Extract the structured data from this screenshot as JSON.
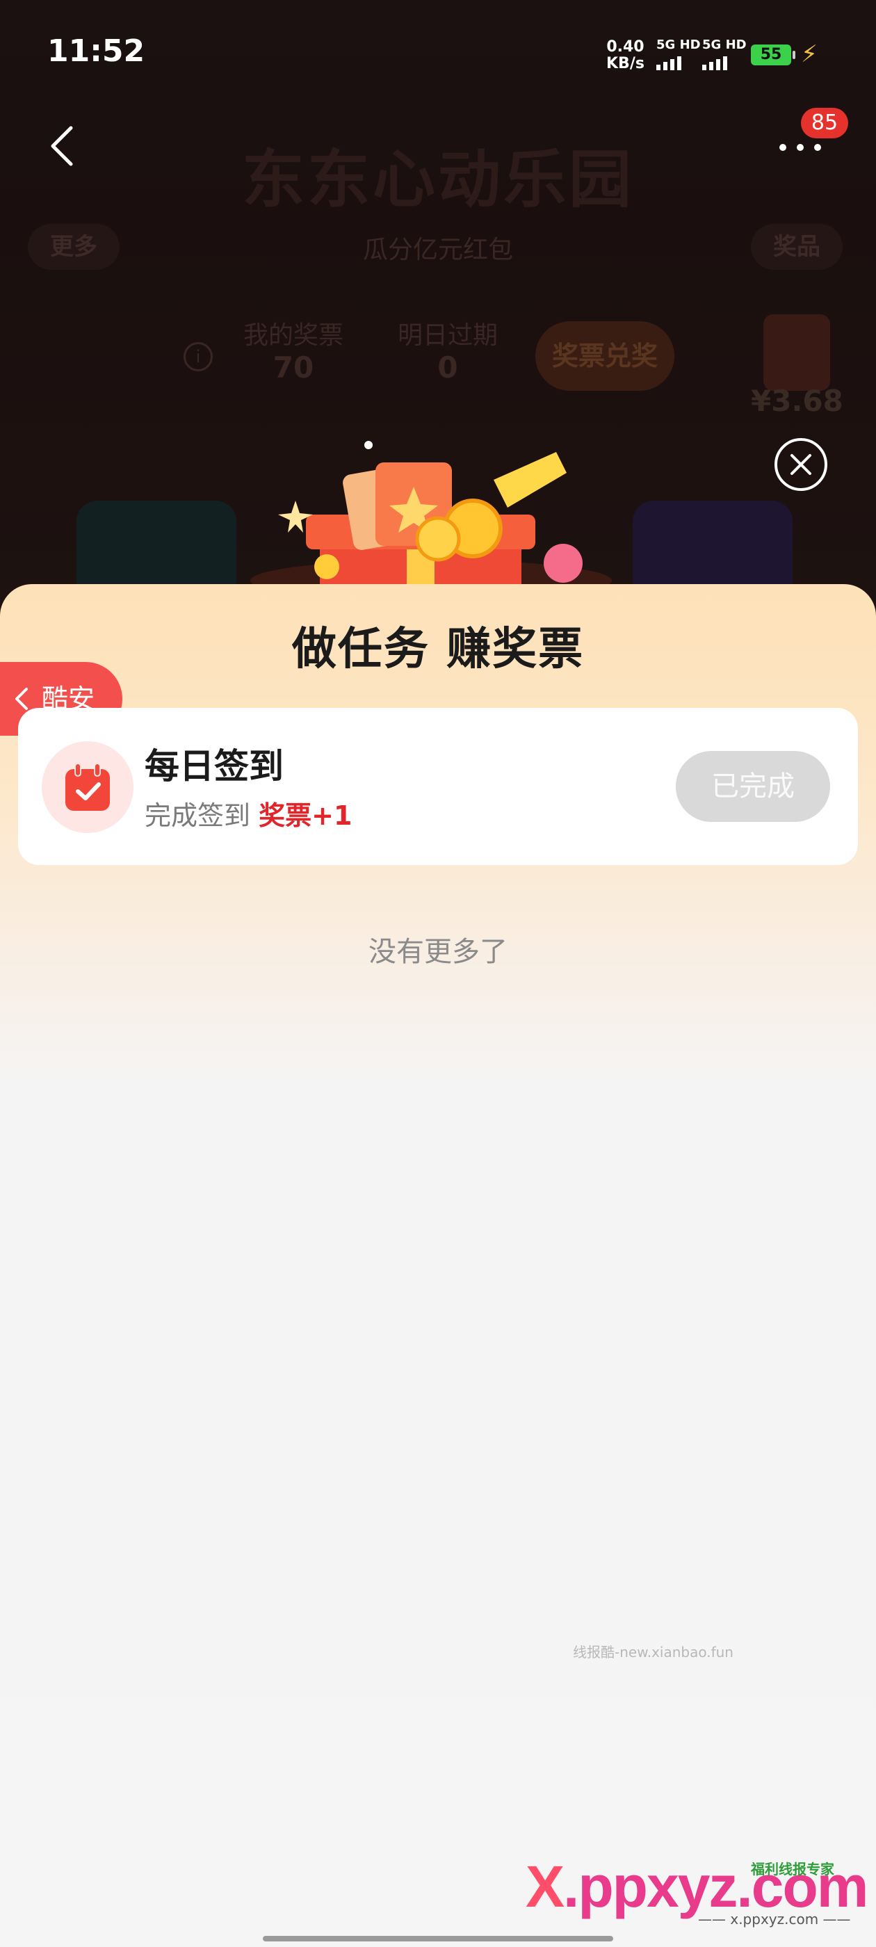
{
  "status_bar": {
    "time": "11:52",
    "net_speed_value": "0.40",
    "net_speed_unit": "KB/s",
    "sim1": "5G HD",
    "sim2": "5G HD",
    "battery": "55"
  },
  "header": {
    "title": "东东心动乐园",
    "subtitle": "瓜分亿元红包",
    "left_pill": "更多",
    "right_pill": "奖品",
    "badge": "85"
  },
  "stats": {
    "tickets_label": "我的奖票",
    "tickets_value": "70",
    "expire_label": "明日过期",
    "expire_value": "0",
    "info": "i",
    "redeem": "奖票兑奖",
    "prize_price": "¥3.68"
  },
  "sheet": {
    "title": "做任务 赚奖票",
    "side_tab": "酷安",
    "tasks": [
      {
        "name": "每日签到",
        "desc": "完成签到",
        "reward": "奖票+1",
        "button": "已完成"
      }
    ],
    "end_text": "没有更多了"
  },
  "watermarks": {
    "site_text": "线报酷-new.xianbao.fun",
    "logo_x": "X",
    "logo_rest": ".ppxyz.com",
    "logo_tag": "福利线报专家",
    "logo_url": "—— x.ppxyz.com ——"
  },
  "colors": {
    "accent_red": "#e0262b",
    "side_tab": "#f24f4d",
    "badge": "#e5322d",
    "done_button": "#d9d9d9"
  }
}
